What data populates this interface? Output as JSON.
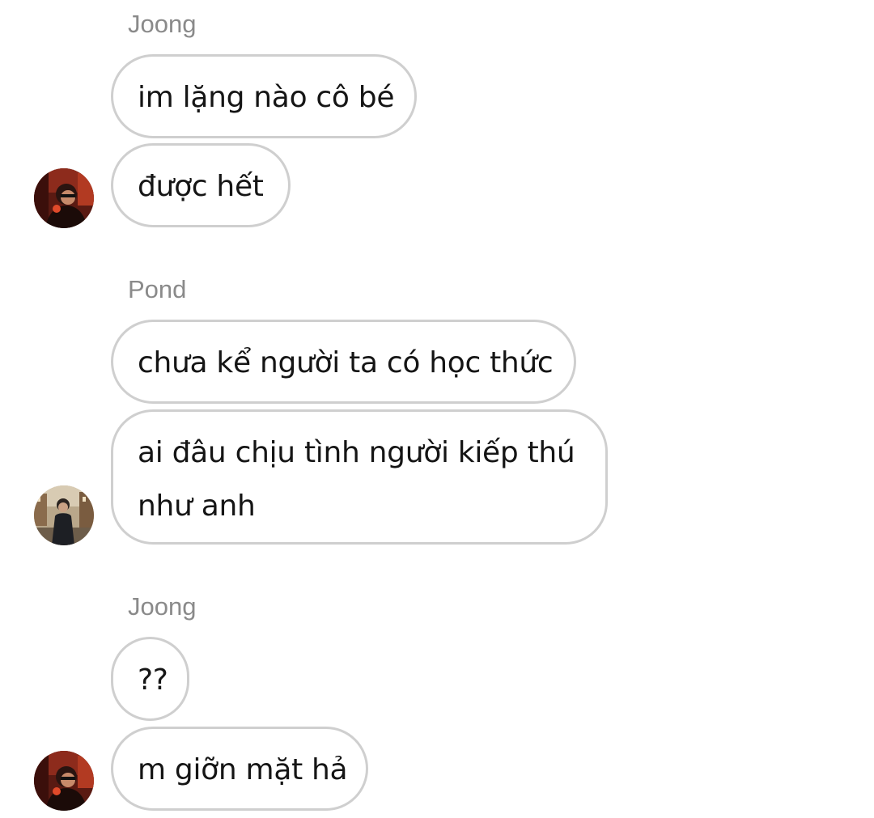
{
  "messages": [
    {
      "sender": "Joong",
      "lines": [
        "im lặng nào cô bé",
        "được hết"
      ]
    },
    {
      "sender": "Pond",
      "lines": [
        "chưa kể người ta có học thức",
        "ai đâu chịu tình người kiếp thú như anh"
      ]
    },
    {
      "sender": "Joong",
      "lines": [
        "??",
        "m giỡn mặt hả"
      ]
    }
  ],
  "avatars": {
    "joong": "person-photo-red-icon",
    "pond": "person-photo-street-icon"
  }
}
